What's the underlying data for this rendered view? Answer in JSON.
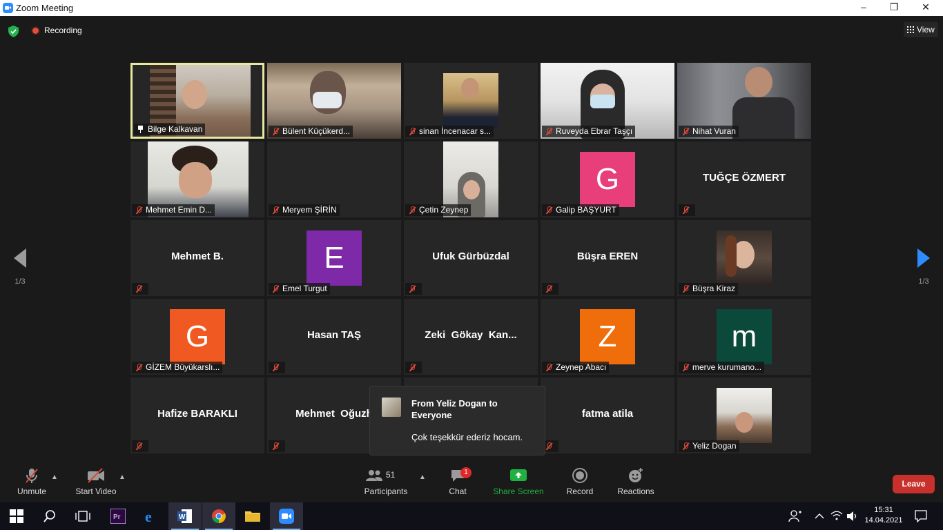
{
  "window": {
    "title": "Zoom Meeting",
    "controls": [
      "–",
      "❐",
      "✕"
    ]
  },
  "header": {
    "recording_label": "Recording",
    "view_label": "View"
  },
  "navigation": {
    "prev_page": "1/3",
    "next_page": "1/3"
  },
  "participants": [
    {
      "name": "Bilge Kalkavan",
      "type": "video",
      "active": true,
      "pinned": true
    },
    {
      "name": "Bülent Küçükerd...",
      "type": "video"
    },
    {
      "name": "sinan İncenacar s...",
      "type": "video"
    },
    {
      "name": "Ruveyda Ebrar Taşçı",
      "type": "video"
    },
    {
      "name": "Nihat Vuran",
      "type": "video"
    },
    {
      "name": "Mehmet Emin D...",
      "type": "video"
    },
    {
      "name": "Meryem ŞİRİN",
      "type": "blank"
    },
    {
      "name": "Çetin Zeynep",
      "type": "photo"
    },
    {
      "name": "Galip BAŞYURT",
      "type": "avatar",
      "letter": "G",
      "color": "#e83e7a"
    },
    {
      "name": "TUĞÇE ÖZMERT",
      "type": "text"
    },
    {
      "name": "Mehmet B.",
      "type": "text"
    },
    {
      "name": "Emel Turgut",
      "type": "avatar",
      "letter": "E",
      "color": "#7e2aa8"
    },
    {
      "name": "Ufuk Gürbüzdal",
      "type": "text"
    },
    {
      "name": "Büşra EREN",
      "type": "text"
    },
    {
      "name": "Büşra Kiraz",
      "type": "photo"
    },
    {
      "name": "GİZEM Büyükarslı...",
      "type": "avatar",
      "letter": "G",
      "color": "#f05a22"
    },
    {
      "name": "Hasan TAŞ",
      "type": "text"
    },
    {
      "name": "Zeki  Gökay  Kan...",
      "type": "text"
    },
    {
      "name": "Zeynep Abacı",
      "type": "avatar",
      "letter": "Z",
      "color": "#f06d0c"
    },
    {
      "name": "merve kurumano...",
      "type": "avatar",
      "letter": "m",
      "color": "#0b4a3a"
    },
    {
      "name": "Hafize BARAKLI",
      "type": "text"
    },
    {
      "name": "Mehmet  Oğuzh",
      "type": "text"
    },
    {
      "name": "",
      "type": "blank"
    },
    {
      "name": "fatma atila",
      "type": "text"
    },
    {
      "name": "Yeliz Dogan",
      "type": "photo"
    }
  ],
  "chat_popup": {
    "from": "From Yeliz Dogan to Everyone",
    "message": "Çok teşekkür ederiz hocam."
  },
  "toolbar": {
    "unmute": "Unmute",
    "start_video": "Start Video",
    "participants": "Participants",
    "participants_count": "51",
    "chat": "Chat",
    "chat_badge": "1",
    "share_screen": "Share Screen",
    "record": "Record",
    "reactions": "Reactions",
    "leave": "Leave"
  },
  "taskbar": {
    "time": "15:31",
    "date": "14.04.2021"
  },
  "colors": {
    "accent": "#2d8cff",
    "share_green": "#1fb142",
    "leave_red": "#c8312b",
    "active_border": "#e8e8a0"
  }
}
